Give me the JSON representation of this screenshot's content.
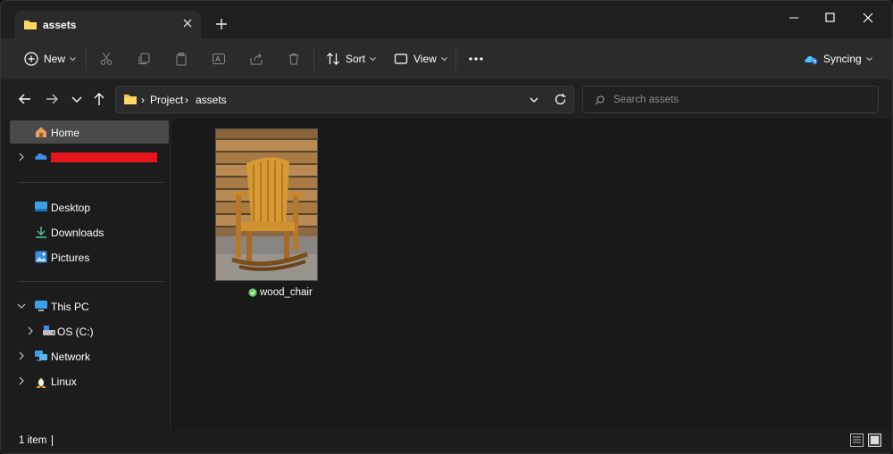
{
  "tabs": [
    {
      "label": "assets"
    }
  ],
  "commandbar": {
    "new_label": "New",
    "sort_label": "Sort",
    "view_label": "View",
    "sync_label": "Syncing"
  },
  "address": {
    "crumbs": [
      "Project",
      "assets"
    ]
  },
  "search": {
    "placeholder": "Search assets"
  },
  "sidebar": {
    "items": [
      {
        "label": "Home"
      },
      {
        "label": "Desktop"
      },
      {
        "label": "Downloads"
      },
      {
        "label": "Pictures"
      },
      {
        "label": "This PC"
      },
      {
        "label": "OS (C:)"
      },
      {
        "label": "Network"
      },
      {
        "label": "Linux"
      }
    ]
  },
  "files": [
    {
      "name": "wood_chair"
    }
  ],
  "status": {
    "item_count": "1 item"
  },
  "colors": {
    "accent": "#4cc2ff",
    "redaction": "#e8141b",
    "folder": "#f7c948",
    "sync_ok": "#6ccb5f"
  }
}
